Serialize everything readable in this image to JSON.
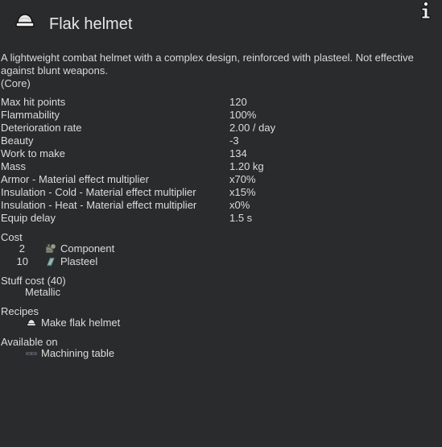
{
  "header": {
    "title": "Flak helmet"
  },
  "description": {
    "text": "A lightweight combat helmet with a complex design, reinforced with plasteel. Not effective against blunt weapons.",
    "source": "(Core)"
  },
  "stats": [
    {
      "label": "Max hit points",
      "value": "120"
    },
    {
      "label": "Flammability",
      "value": "100%"
    },
    {
      "label": "Deterioration rate",
      "value": "2.00 / day"
    },
    {
      "label": "Beauty",
      "value": "-3"
    },
    {
      "label": "Work to make",
      "value": "134"
    },
    {
      "label": "Mass",
      "value": "1.20 kg"
    },
    {
      "label": "Armor - Material effect multiplier",
      "value": "x70%"
    },
    {
      "label": "Insulation - Cold - Material effect multiplier",
      "value": "x15%"
    },
    {
      "label": "Insulation - Heat - Material effect multiplier",
      "value": "x0%"
    },
    {
      "label": "Equip delay",
      "value": "1.5 s"
    }
  ],
  "cost": {
    "title": "Cost",
    "items": [
      {
        "qty": "2",
        "name": "Component",
        "icon": "component-icon"
      },
      {
        "qty": "10",
        "name": "Plasteel",
        "icon": "plasteel-icon"
      }
    ]
  },
  "stuff_cost": {
    "title": "Stuff cost (40)",
    "category": "Metallic"
  },
  "recipes": {
    "title": "Recipes",
    "items": [
      {
        "label": "Make flak helmet",
        "icon": "helmet-icon"
      }
    ]
  },
  "available_on": {
    "title": "Available on",
    "items": [
      {
        "label": "Machining table",
        "icon": "machining-table-icon"
      }
    ]
  },
  "colors": {
    "background": "#2a2b2c",
    "text": "#dcdcdc",
    "title": "#e6e6e6"
  }
}
